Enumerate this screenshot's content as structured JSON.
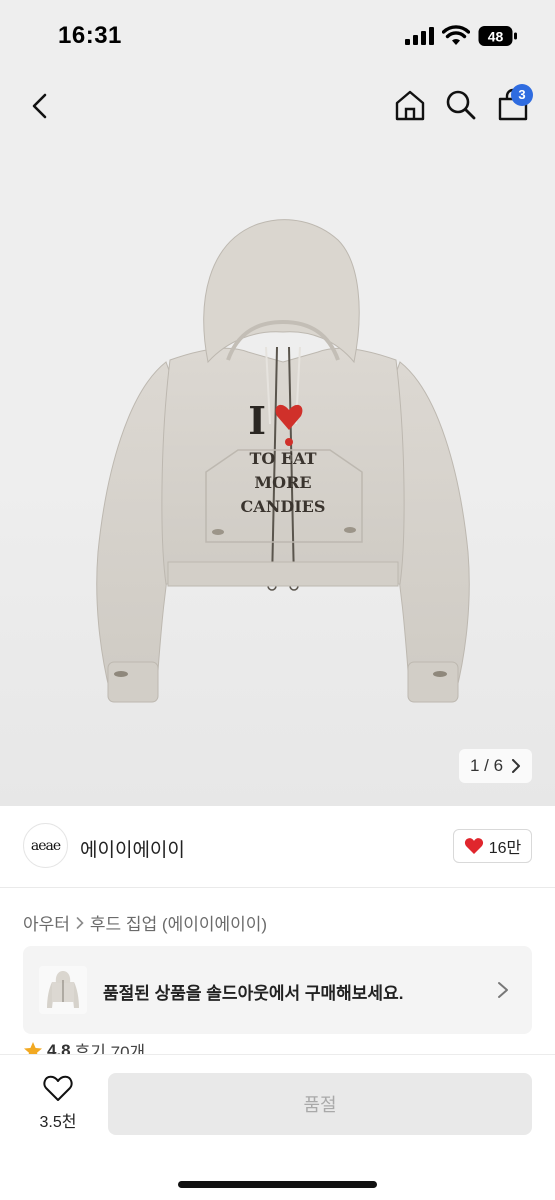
{
  "status_bar": {
    "time": "16:31",
    "battery": "48"
  },
  "nav": {
    "cart_count": "3"
  },
  "hero": {
    "print_line1": "I",
    "print_line2": "TO EAT",
    "print_line3": "MORE",
    "print_line4": "CANDIES",
    "counter": "1 / 6"
  },
  "brand": {
    "logo_text": "aeae",
    "name": "에이이에이이",
    "likes": "16만"
  },
  "breadcrumb": {
    "level1": "아우터",
    "level2": "후드 집업 (에이이에이이)"
  },
  "soldout": {
    "text": "품절된 상품을 솔드아웃에서 구매해보세요."
  },
  "rating": {
    "score": "4.8",
    "reviews": "후기 70개"
  },
  "bottom": {
    "wish_count": "3.5천",
    "buy_label": "품절"
  },
  "colors": {
    "accent": "#2f6ce0",
    "heart": "#e0262d",
    "hero_bg": "#eeeeee"
  }
}
